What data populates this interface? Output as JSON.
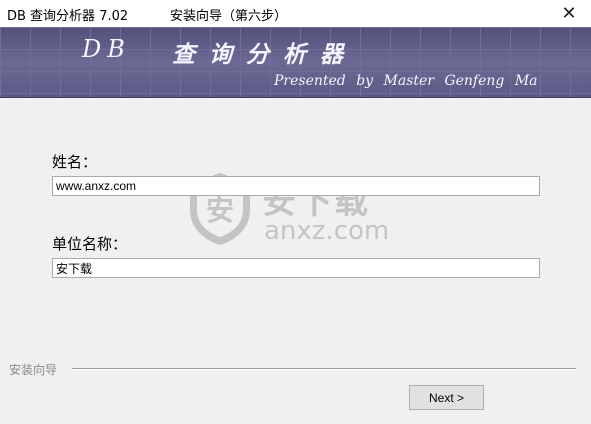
{
  "window": {
    "app_title": "DB 查询分析器 7.02",
    "step_title": "安装向导（第六步）",
    "close_glyph": "✕"
  },
  "banner": {
    "db_text": "DB",
    "cn_title": "查询分析器",
    "credit": "Presented by Master Genfeng Ma"
  },
  "form": {
    "name_label": "姓名：",
    "name_value": "www.anxz.com",
    "org_label": "单位名称：",
    "org_value": "安下载"
  },
  "watermark": {
    "shield_glyph": "安",
    "cn": "安下载",
    "en": "anxz.com",
    "icon": "shield-icon"
  },
  "footer": {
    "wizard_label": "安装向导",
    "next_label": "Next >"
  },
  "colors": {
    "banner_bg": "#5a5a86",
    "window_bg": "#f0f0f0"
  }
}
